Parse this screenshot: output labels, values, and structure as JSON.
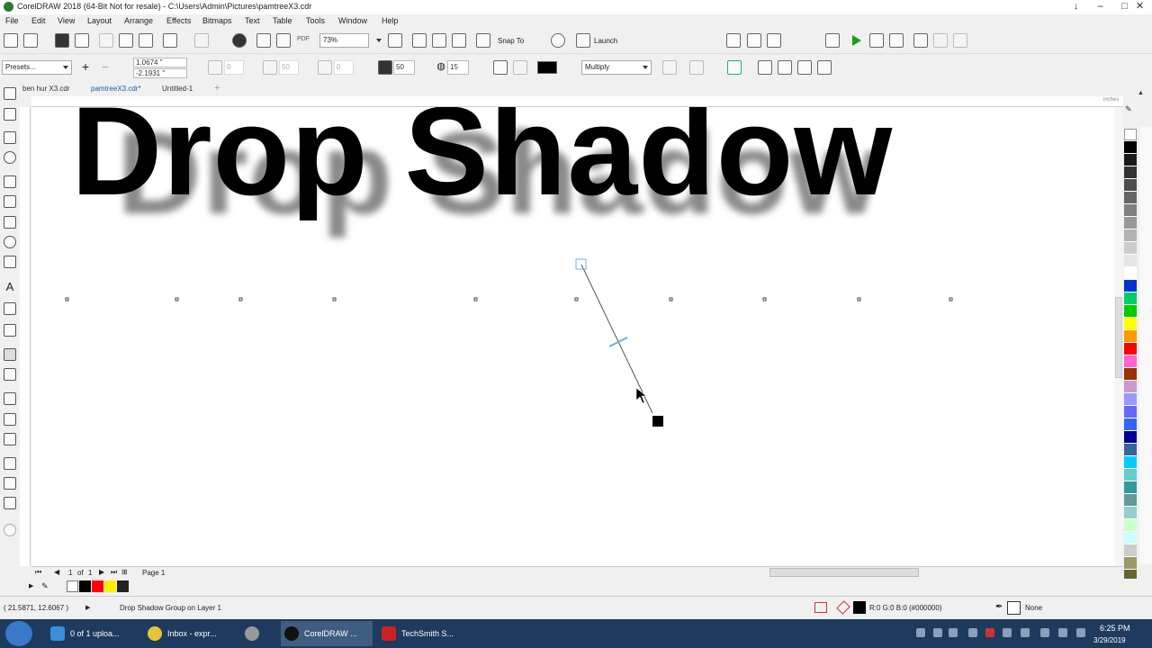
{
  "window": {
    "title": "CorelDRAW 2018 (64-Bit Not for resale) - C:\\Users\\Admin\\Pictures\\pamtreeX3.cdr",
    "controls": [
      "↓",
      "–",
      "□",
      "✕"
    ]
  },
  "menu": [
    "File",
    "Edit",
    "View",
    "Layout",
    "Arrange",
    "Effects",
    "Bitmaps",
    "Text",
    "Table",
    "Tools",
    "Window",
    "Help"
  ],
  "toolbar": {
    "zoom": "73%",
    "snap_to": "Snap To",
    "launch": "Launch",
    "pdf_label": "PDF"
  },
  "propbar": {
    "presets": "Presets...",
    "x_value": "1.0674 \"",
    "y_value": "-2.1931 \"",
    "dir_value": "0",
    "opacity_value": "50",
    "feather_value": "0",
    "transparency_value": "50",
    "feather2_value": "15",
    "merge_mode": "Multiply"
  },
  "tabs": [
    {
      "label": "ben hur X3.cdr",
      "active": false
    },
    {
      "label": "pamtreeX3.cdr*",
      "active": true
    },
    {
      "label": "Untitled-1",
      "active": false
    }
  ],
  "ruler": {
    "unit": "inches"
  },
  "canvas": {
    "main_text": "Drop Shadow",
    "shadow_text": "Drop Shadow"
  },
  "pagebar": {
    "page_of": "1",
    "of_label": "of",
    "total": "1",
    "page_tab": "Page 1"
  },
  "status": {
    "coords": "( 21.5871, 12.6067 )",
    "object": "Drop Shadow Group on Layer 1",
    "fill": "R:0 G:0 B:0 (#000000)",
    "outline": "None"
  },
  "taskbar": {
    "items": [
      "0 of 1 uploa...",
      "Inbox - expr...",
      "",
      "CorelDRAW ...",
      "TechSmith S..."
    ],
    "time": "6:25 PM",
    "date": "3/29/2019"
  },
  "palette_colors": [
    "#000000",
    "#1a1a1a",
    "#333333",
    "#4d4d4d",
    "#666666",
    "#808080",
    "#999999",
    "#b3b3b3",
    "#cccccc",
    "#e6e6e6",
    "#ffffff",
    "#0033cc",
    "#00cc66",
    "#00cc00",
    "#ffff00",
    "#ff9900",
    "#ff0000",
    "#ff66cc",
    "#993300",
    "#cc99cc",
    "#9999ff",
    "#6666ff",
    "#3366ff",
    "#000099",
    "#336699",
    "#00ccff",
    "#66cccc",
    "#339999",
    "#669999",
    "#99cccc",
    "#ccffcc",
    "#ccffff",
    "#cccccc",
    "#999966",
    "#666633"
  ]
}
